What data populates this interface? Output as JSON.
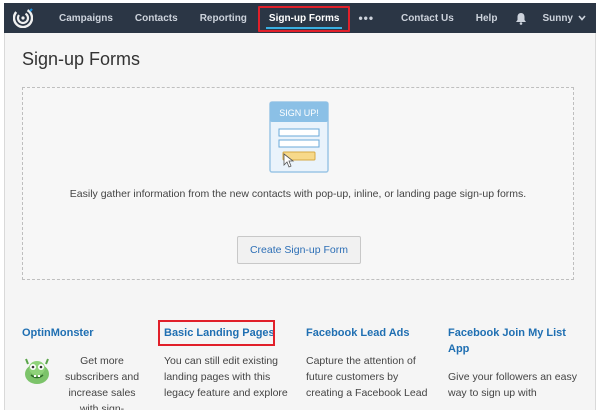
{
  "nav": {
    "items": [
      "Campaigns",
      "Contacts",
      "Reporting",
      "Sign-up Forms"
    ],
    "more_label": "•••",
    "right_items": [
      "Contact Us",
      "Help"
    ],
    "user_label": "Sunny"
  },
  "page": {
    "title": "Sign-up Forms"
  },
  "empty_state": {
    "illustration_text": "SIGN UP!",
    "description": "Easily gather information from the new contacts with pop-up, inline, or landing page sign-up forms.",
    "button_label": "Create Sign-up Form"
  },
  "integrations": [
    {
      "title": "OptinMonster",
      "body": "Get more subscribers and increase sales with sign-"
    },
    {
      "title": "Basic Landing Pages",
      "body": "You can still edit existing landing pages with this legacy feature and explore"
    },
    {
      "title": "Facebook Lead Ads",
      "body": "Capture the attention of future customers by creating a Facebook Lead"
    },
    {
      "title": "Facebook Join My List App",
      "body": "Give your followers an easy way to sign up with"
    }
  ],
  "colors": {
    "nav_bg": "#2b3645",
    "highlight_red": "#e1202a",
    "link_blue": "#1f6fb2",
    "active_underline": "#3ab0e2"
  }
}
